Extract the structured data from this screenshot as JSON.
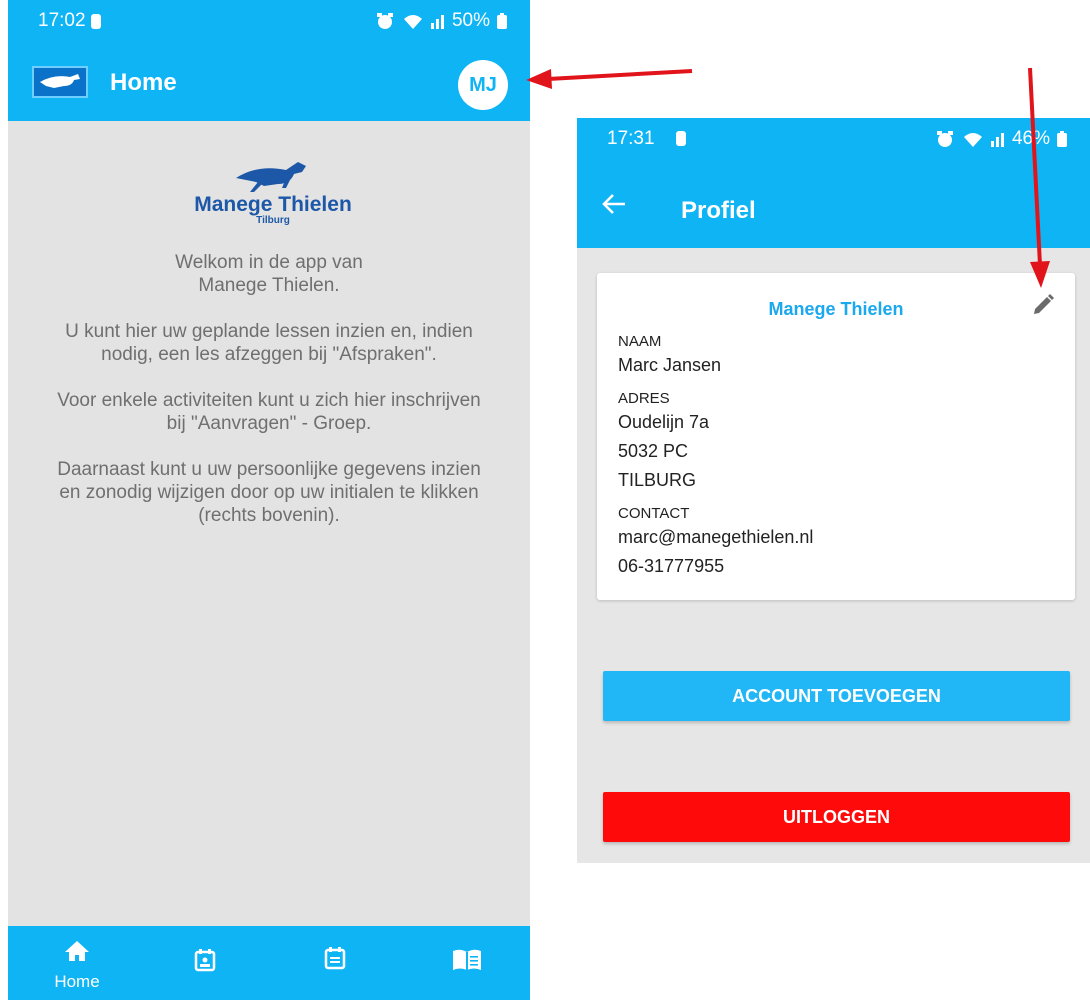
{
  "colors": {
    "accent": "#0fb4f5",
    "brand_blue": "#1c57a8",
    "logout_red": "#ff0a0a",
    "annotation_red": "#e0141a"
  },
  "left_screen": {
    "status": {
      "time": "17:02",
      "battery": "50%"
    },
    "header": {
      "title": "Home",
      "avatar_initials": "MJ"
    },
    "brand": {
      "name": "Manege Thielen",
      "city": "Tilburg"
    },
    "paragraphs": [
      "Welkom in de app van\nManege Thielen.",
      "U kunt hier uw geplande lessen inzien en, indien\nnodig, een les afzeggen bij \"Afspraken\".",
      "Voor enkele activiteiten kunt u zich hier inschrijven\nbij \"Aanvragen\" - Groep.",
      "Daarnaast kunt u uw persoonlijke gegevens inzien\nen zonodig wijzigen door op uw initialen te klikken\n(rechts bovenin)."
    ],
    "bottom_nav": [
      {
        "icon": "home-icon",
        "label": "Home"
      },
      {
        "icon": "calendar-person-icon",
        "label": ""
      },
      {
        "icon": "calendar-list-icon",
        "label": ""
      },
      {
        "icon": "book-icon",
        "label": ""
      }
    ]
  },
  "right_screen": {
    "status": {
      "time": "17:31",
      "battery": "46%"
    },
    "header": {
      "title": "Profiel"
    },
    "profile": {
      "organization": "Manege Thielen",
      "naam_label": "NAAM",
      "naam": "Marc Jansen",
      "adres_label": "ADRES",
      "street": "Oudelijn 7a",
      "postal": "5032 PC",
      "city": "TILBURG",
      "contact_label": "CONTACT",
      "email": "marc@manegethielen.nl",
      "phone": "06-31777955"
    },
    "buttons": {
      "add_account": "ACCOUNT TOEVOEGEN",
      "logout": "UITLOGGEN"
    }
  }
}
